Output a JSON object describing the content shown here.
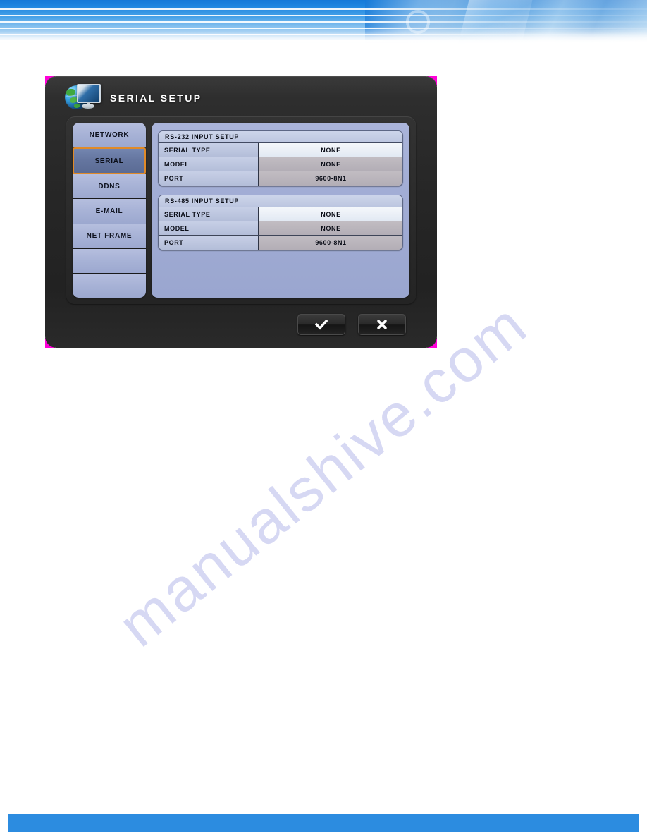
{
  "page": {
    "banner": {
      "name": "decorative-blue-header-banner"
    },
    "footer_bar": {
      "name": "decorative-blue-footer-bar"
    },
    "watermark": {
      "text": "manualshive.com"
    },
    "colors": {
      "banner_blue": "#1579d8",
      "footer_blue": "#2c8ce0",
      "panel_periwinkle": "#a2add5",
      "selected_item_blue": "#64759f",
      "selected_item_border": "#e08a28",
      "dialog_dark": "#262626",
      "corner_marker_magenta": "#ff00d8",
      "watermark_lavender": "#c9cbf0",
      "value_active_bg": "#f4f7fb",
      "value_disabled_bg": "#b9b4bb"
    }
  },
  "dialog": {
    "title": "SERIAL SETUP",
    "title_icon": "globe-monitor-icon",
    "sidebar": {
      "items": [
        {
          "label": "NETWORK",
          "selected": false
        },
        {
          "label": "SERIAL",
          "selected": true
        },
        {
          "label": "DDNS",
          "selected": false
        },
        {
          "label": "E-MAIL",
          "selected": false
        },
        {
          "label": "NET FRAME",
          "selected": false
        },
        {
          "label": "",
          "selected": false
        },
        {
          "label": "",
          "selected": false
        }
      ]
    },
    "groups": [
      {
        "title": "RS-232 INPUT SETUP",
        "rows": [
          {
            "label": "SERIAL TYPE",
            "value": "NONE",
            "state": "active"
          },
          {
            "label": "MODEL",
            "value": "NONE",
            "state": "disabled"
          },
          {
            "label": "PORT",
            "value": "9600-8N1",
            "state": "disabled"
          }
        ]
      },
      {
        "title": "RS-485 INPUT SETUP",
        "rows": [
          {
            "label": "SERIAL TYPE",
            "value": "NONE",
            "state": "active"
          },
          {
            "label": "MODEL",
            "value": "NONE",
            "state": "disabled"
          },
          {
            "label": "PORT",
            "value": "9600-8N1",
            "state": "disabled"
          }
        ]
      }
    ],
    "footer": {
      "confirm_icon": "check-icon",
      "cancel_icon": "close-icon"
    }
  }
}
